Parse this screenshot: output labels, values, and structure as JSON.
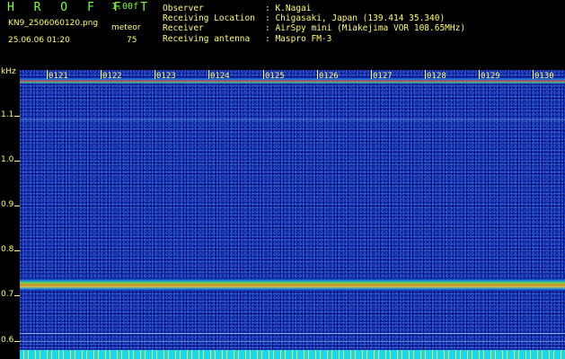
{
  "header": {
    "app_title": "H R O F F T",
    "version": "1.00f",
    "filename": "KN9_2506060120.png",
    "meteor_label": "meteor",
    "datetime": "25.06.06 01:20",
    "meteor_count": "75"
  },
  "info": [
    {
      "key": "Observer",
      "value": ": K.Nagai"
    },
    {
      "key": "Receiving Location",
      "value": ": Chigasaki, Japan (139.414 35.340)"
    },
    {
      "key": "Receiver",
      "value": ": AirSpy mini (Miakejima VOR 108.65MHz)"
    },
    {
      "key": "Receiving antenna",
      "value": ": Maspro FM-3"
    }
  ],
  "axis": {
    "unit": "kHz",
    "y_ticks": [
      "1.1",
      "1.0",
      "0.9",
      "0.8",
      "0.7",
      "0.6"
    ]
  },
  "time_marks": [
    "0121",
    "0122",
    "0123",
    "0124",
    "0125",
    "0126",
    "0127",
    "0128",
    "0129",
    "0130"
  ],
  "colors": {
    "label": "#ffff66",
    "title": "#7cff3a",
    "background": "#07148a",
    "main_band": "#e07a2a",
    "floor": "#17d8f0"
  }
}
